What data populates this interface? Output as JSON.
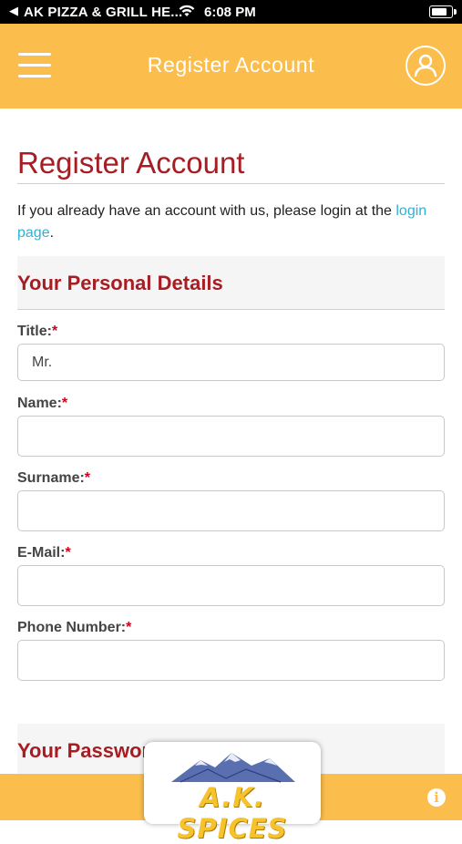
{
  "status_bar": {
    "back_arrow": "◀",
    "carrier": "AK PIZZA & GRILL HE...",
    "time": "6:08 PM",
    "battery_level": 0.85
  },
  "header": {
    "title": "Register Account",
    "menu_icon": "hamburger-menu-icon",
    "profile_icon": "user-profile-icon",
    "background_color": "#fbbd4c"
  },
  "page": {
    "title": "Register Account",
    "intro_text": "If you already have an account with us, please login at the ",
    "intro_link": "login page",
    "intro_suffix": "."
  },
  "personal_details": {
    "heading": "Your Personal Details",
    "fields": [
      {
        "label": "Title:",
        "required_mark": "*",
        "value": "Mr."
      },
      {
        "label": "Name:",
        "required_mark": "*",
        "value": ""
      },
      {
        "label": "Surname:",
        "required_mark": "*",
        "value": ""
      },
      {
        "label": "E-Mail:",
        "required_mark": "*",
        "value": ""
      },
      {
        "label": "Phone Number:",
        "required_mark": "*",
        "value": ""
      }
    ]
  },
  "password_section": {
    "heading": "Your Password"
  },
  "footer": {
    "logo_text": "A.K. SPICES",
    "info_icon": "info-icon",
    "info_glyph": "i"
  },
  "colors": {
    "accent": "#fbbd4c",
    "heading_red": "#a61d24",
    "link": "#2fb2d6",
    "required": "#d0021b"
  }
}
